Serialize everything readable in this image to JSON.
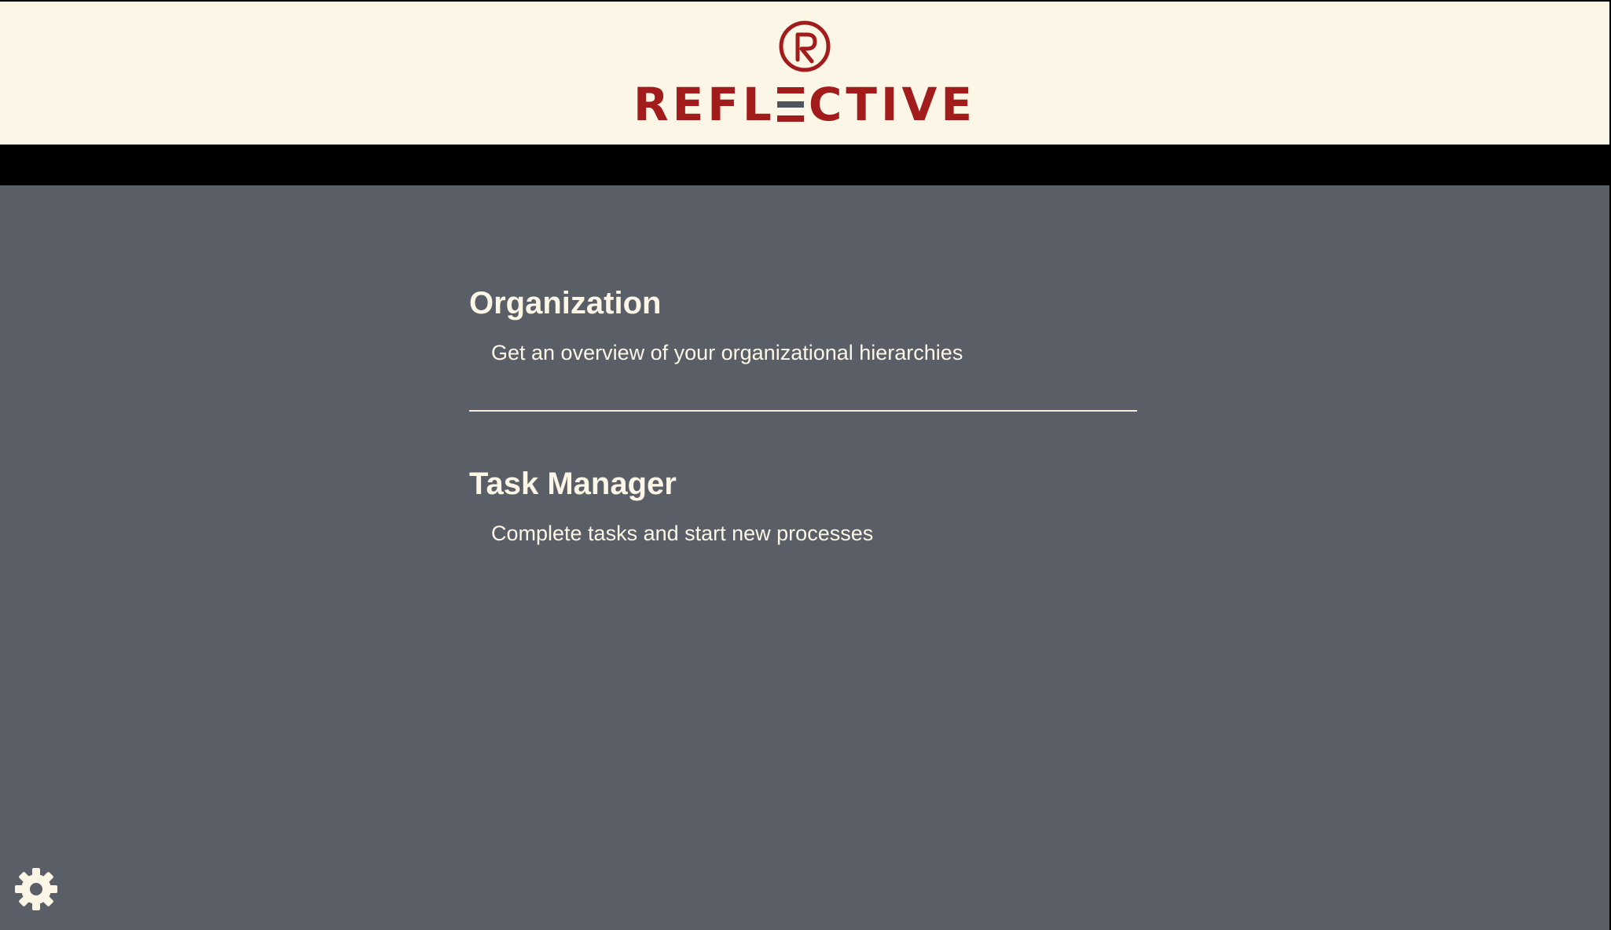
{
  "header": {
    "logo_text_start": "REFL",
    "logo_text_end": "CTIVE",
    "logo_mark": "R"
  },
  "main": {
    "sections": [
      {
        "title": "Organization",
        "description": "Get an overview of your organizational hierarchies"
      },
      {
        "title": "Task Manager",
        "description": "Complete tasks and start new processes"
      }
    ]
  },
  "footer": {
    "settings_icon": "gear-icon"
  },
  "colors": {
    "header_bg": "#fcf6e6",
    "brand_red": "#a31c1c",
    "nav_bg": "#000000",
    "page_bg": "#5a5e66",
    "text": "#fcf6e6"
  }
}
